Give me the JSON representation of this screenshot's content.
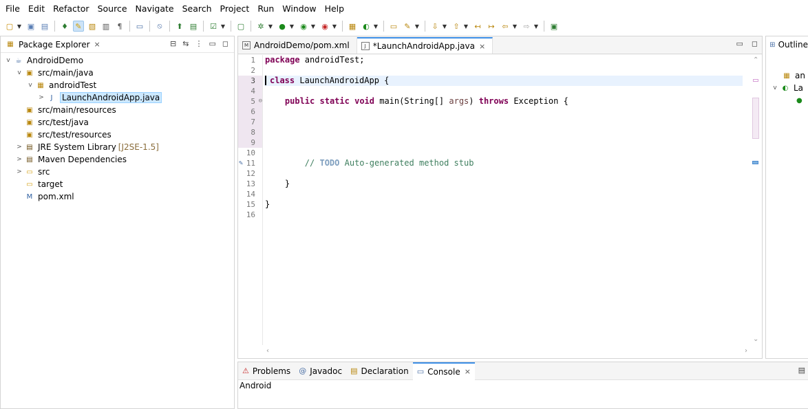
{
  "menu": [
    "File",
    "Edit",
    "Refactor",
    "Source",
    "Navigate",
    "Search",
    "Project",
    "Run",
    "Window",
    "Help"
  ],
  "package_explorer": {
    "title": "Package Explorer",
    "close": "×",
    "tree": [
      {
        "label": "AndroidDemo",
        "level": 0,
        "twisty": "v",
        "icon": "project-icon",
        "glyph": "☕"
      },
      {
        "label": "src/main/java",
        "level": 1,
        "twisty": "v",
        "icon": "source-folder-icon",
        "glyph": "▣"
      },
      {
        "label": "androidTest",
        "level": 2,
        "twisty": "v",
        "icon": "package-icon",
        "glyph": "▦"
      },
      {
        "label": "LaunchAndroidApp.java",
        "level": 3,
        "twisty": ">",
        "icon": "java-file-icon",
        "glyph": "J",
        "selected": true
      },
      {
        "label": "src/main/resources",
        "level": 1,
        "twisty": "",
        "icon": "source-folder-icon",
        "glyph": "▣"
      },
      {
        "label": "src/test/java",
        "level": 1,
        "twisty": "",
        "icon": "source-folder-icon",
        "glyph": "▣"
      },
      {
        "label": "src/test/resources",
        "level": 1,
        "twisty": "",
        "icon": "source-folder-icon",
        "glyph": "▣"
      },
      {
        "label": "JRE System Library",
        "decor": "[J2SE-1.5]",
        "level": 1,
        "twisty": ">",
        "icon": "library-icon",
        "glyph": "▤"
      },
      {
        "label": "Maven Dependencies",
        "level": 1,
        "twisty": ">",
        "icon": "library-icon",
        "glyph": "▤"
      },
      {
        "label": "src",
        "level": 1,
        "twisty": ">",
        "icon": "folder-icon",
        "glyph": "▭"
      },
      {
        "label": "target",
        "level": 1,
        "twisty": "",
        "icon": "folder-icon",
        "glyph": "▭"
      },
      {
        "label": "pom.xml",
        "level": 1,
        "twisty": "",
        "icon": "xml-file-icon",
        "glyph": "M"
      }
    ]
  },
  "editor": {
    "tabs": [
      {
        "label": "AndroidDemo/pom.xml",
        "icon": "M",
        "active": false
      },
      {
        "label": "*LaunchAndroidApp.java",
        "icon": "J",
        "active": true,
        "close": "×"
      }
    ],
    "line_numbers": [
      "1",
      "2",
      "3",
      "4",
      "5",
      "6",
      "7",
      "8",
      "9",
      "10",
      "11",
      "12",
      "13",
      "14",
      "15",
      "16"
    ],
    "lines": {
      "l1_kw": "package",
      "l1_rest": " androidTest;",
      "l3_kw": "class",
      "l3_rest": " LaunchAndroidApp {",
      "l5_kw1": "public",
      "l5_kw2": "static",
      "l5_kw3": "void",
      "l5_mid": " main(String[] ",
      "l5_param": "args",
      "l5_sep": ") ",
      "l5_kw4": "throws",
      "l5_end": " Exception {",
      "l11_cm1": "// ",
      "l11_todo": "TODO",
      "l11_cm2": " Auto-generated method stub",
      "l13": "}",
      "l15": "}"
    }
  },
  "outline": {
    "title": "Outline",
    "items": [
      "an",
      "La"
    ]
  },
  "console": {
    "tabs": [
      {
        "label": "Problems",
        "icon": "problems-icon",
        "glyph": "⚠"
      },
      {
        "label": "Javadoc",
        "icon": "javadoc-icon",
        "glyph": "@"
      },
      {
        "label": "Declaration",
        "icon": "declaration-icon",
        "glyph": "▤"
      },
      {
        "label": "Console",
        "icon": "console-icon",
        "glyph": "▭",
        "active": true,
        "close": "×"
      }
    ],
    "text": "Android"
  }
}
